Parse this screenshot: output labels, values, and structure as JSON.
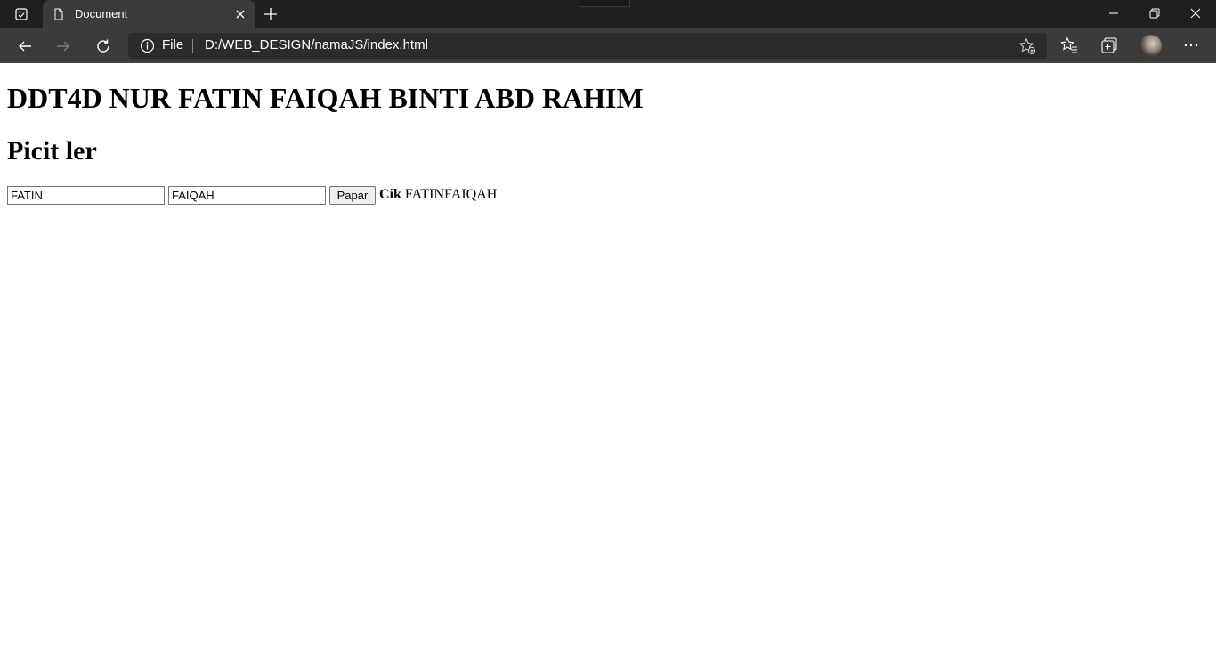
{
  "browser": {
    "tab_title": "Document",
    "scheme_label": "File",
    "url": "D:/WEB_DESIGN/namaJS/index.html",
    "icons": {
      "tab_actions": "tab-actions-icon",
      "favicon": "page-icon",
      "tab_close": "close-icon",
      "new_tab": "plus-icon",
      "back": "back-arrow-icon",
      "forward": "forward-arrow-icon",
      "reload": "reload-icon",
      "site_info": "info-icon",
      "add_favorite": "star-add-icon",
      "favorites": "favorites-icon",
      "collections": "collections-icon",
      "profile": "avatar",
      "more": "more-icon",
      "minimize": "minimize-icon",
      "restore": "restore-icon",
      "close_window": "close-icon"
    },
    "colors": {
      "tabstrip_bg": "#1f1f1f",
      "toolbar_bg": "#3b3b3b",
      "address_bg": "#2b2b2b"
    }
  },
  "page": {
    "heading": "DDT4D NUR FATIN FAIQAH BINTI ABD RAHIM",
    "subheading": "Picit ler",
    "form": {
      "first_value": "FATIN",
      "last_value": "FAIQAH",
      "button_label": "Papar",
      "result_prefix": "Cik",
      "result_text": "FATINFAIQAH"
    }
  }
}
